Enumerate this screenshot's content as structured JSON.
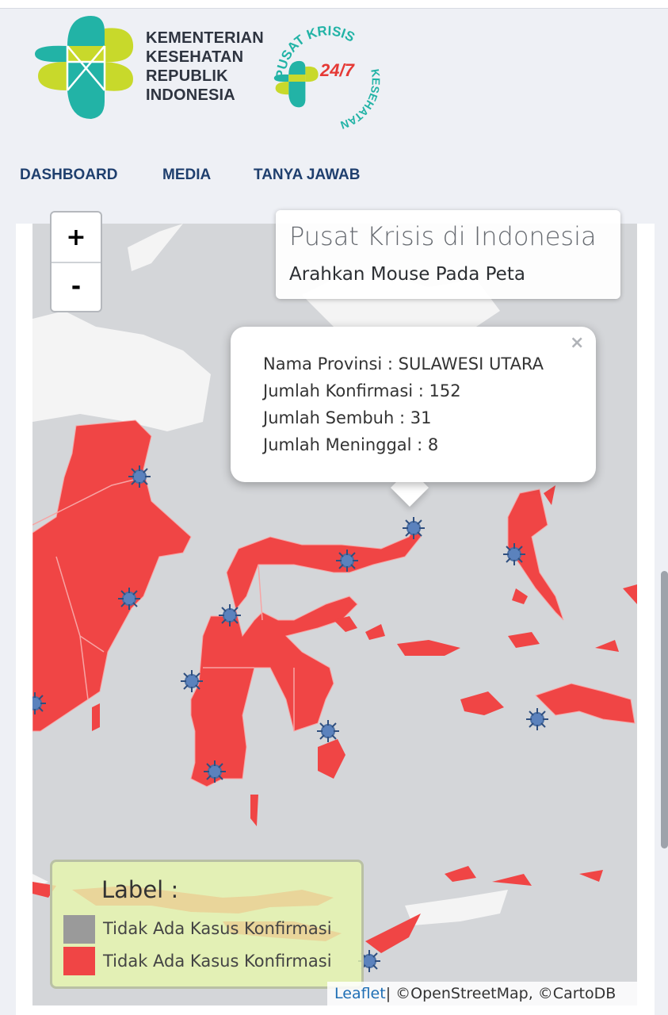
{
  "header": {
    "ministry_lines": [
      "KEMENTERIAN",
      "KESEHATAN",
      "REPUBLIK",
      "INDONESIA"
    ],
    "badge_arc_top": "PUSAT KRISIS",
    "badge_arc_bottom": "KESEHATAN",
    "badge_center": "24/7"
  },
  "nav": {
    "items": [
      "DASHBOARD",
      "MEDIA",
      "TANYA JAWAB"
    ]
  },
  "map": {
    "zoom_in": "+",
    "zoom_out": "-",
    "info_title": "Pusat Krisis di Indonesia",
    "info_subtitle": "Arahkan Mouse Pada Peta",
    "popup": {
      "close": "×",
      "province": "Nama Provinsi : SULAWESI UTARA",
      "confirmed": "Jumlah Konfirmasi : 152",
      "recovered": "Jumlah Sembuh : 31",
      "deaths": "Jumlah Meninggal : 8"
    },
    "legend": {
      "title": "Label :",
      "items": [
        {
          "label": "Tidak Ada Kasus Konfirmasi",
          "color": "#9a9a9a"
        },
        {
          "label": "Tidak Ada Kasus Konfirmasi",
          "color": "#f04545"
        }
      ]
    },
    "attribution": {
      "leaflet": "Leaflet",
      "rest": " | ©OpenStreetMap, ©CartoDB"
    }
  },
  "colors": {
    "province_fill": "#f04545",
    "water": "#d4d6d9",
    "land_other": "#f2f2f2",
    "logo_teal": "#22b3a6",
    "logo_lime": "#c8d92b",
    "nav_text": "#1f3f6e"
  }
}
